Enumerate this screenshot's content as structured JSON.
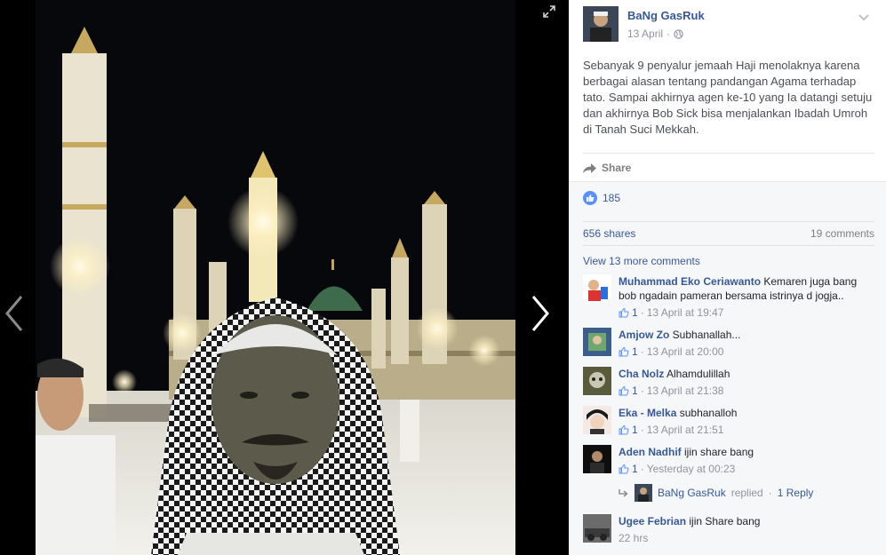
{
  "viewer": {
    "nav_prev": "previous-photo",
    "nav_next": "next-photo",
    "expand": "fullscreen"
  },
  "post": {
    "author": "BaNg GasRuk",
    "date": "13 April",
    "separator": "·",
    "privacy_icon": "globe-icon",
    "text": "Sebanyak 9 penyalur jemaah Haji menolaknya karena berbagai alasan tentang pandangan Agama terhadap tato. Sampai akhirnya agen ke-10 yang Ia datangi setuju dan akhirnya Bob Sick bisa menjalankan Ibadah Umroh di Tanah Suci Mekkah.",
    "share_label": "Share"
  },
  "ufi": {
    "reactions_count": "185",
    "shares": "656 shares",
    "comments": "19 comments",
    "view_more": "View 13 more comments"
  },
  "comments": [
    {
      "name": "Muhammad Eko Ceriawanto",
      "text": "Kemaren juga bang bob ngadain pameran bersama istrinya d jogja..",
      "likes": "1",
      "time": "13 April at 19:47"
    },
    {
      "name": "Amjow Zo",
      "text": "Subhanallah...",
      "likes": "1",
      "time": "13 April at 20:00"
    },
    {
      "name": "Cha Nolz",
      "text": "Alhamdulillah",
      "likes": "1",
      "time": "13 April at 21:38"
    },
    {
      "name": "Eka - Melka",
      "text": "subhanalloh",
      "likes": "1",
      "time": "13 April at 21:51"
    },
    {
      "name": "Aden Nadhif",
      "text": "ijin share bang",
      "likes": "1",
      "time": "Yesterday at 00:23"
    },
    {
      "name": "Ugee Febrian",
      "text": "ijin Share bang",
      "time": "22 hrs"
    }
  ],
  "reply": {
    "author": "BaNg GasRuk",
    "action": "replied",
    "separator": "·",
    "count_label": "1 Reply"
  },
  "colors": {
    "link": "#365899",
    "meta": "#90949c",
    "like_blue": "#5890ff",
    "ufi_bg": "#f6f7f9"
  }
}
